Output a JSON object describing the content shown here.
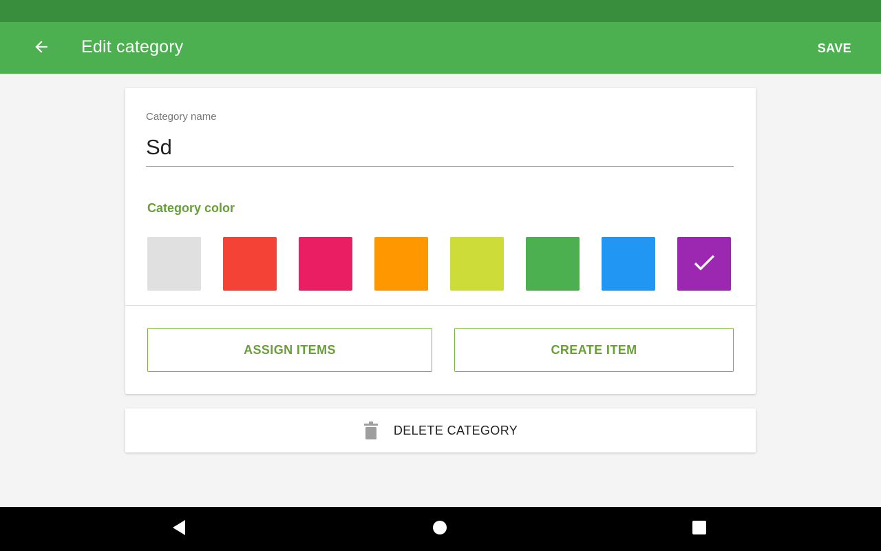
{
  "app_bar": {
    "title": "Edit category",
    "save_label": "SAVE",
    "back_icon": "arrow-back-icon",
    "color": "#4caf50",
    "status_bar_color": "#388e3c"
  },
  "form": {
    "name_label": "Category name",
    "name_value": "Sd",
    "color_heading": "Category color",
    "selected_color_index": 7,
    "colors": [
      {
        "name": "grey",
        "hex": "#e0e0e0"
      },
      {
        "name": "red",
        "hex": "#f44336"
      },
      {
        "name": "pink",
        "hex": "#e91e63"
      },
      {
        "name": "orange",
        "hex": "#ff9800"
      },
      {
        "name": "lime",
        "hex": "#cddc39"
      },
      {
        "name": "green",
        "hex": "#4caf50"
      },
      {
        "name": "blue",
        "hex": "#2196f3"
      },
      {
        "name": "purple",
        "hex": "#9c27b0"
      }
    ],
    "selected_icon": "check-icon"
  },
  "actions": {
    "assign_label": "ASSIGN ITEMS",
    "create_label": "CREATE ITEM",
    "accent_color": "#689f38"
  },
  "delete": {
    "label": "DELETE CATEGORY",
    "icon": "trash-icon"
  },
  "navigation": {
    "back_icon": "nav-back-icon",
    "home_icon": "nav-home-icon",
    "recents_icon": "nav-recents-icon"
  }
}
